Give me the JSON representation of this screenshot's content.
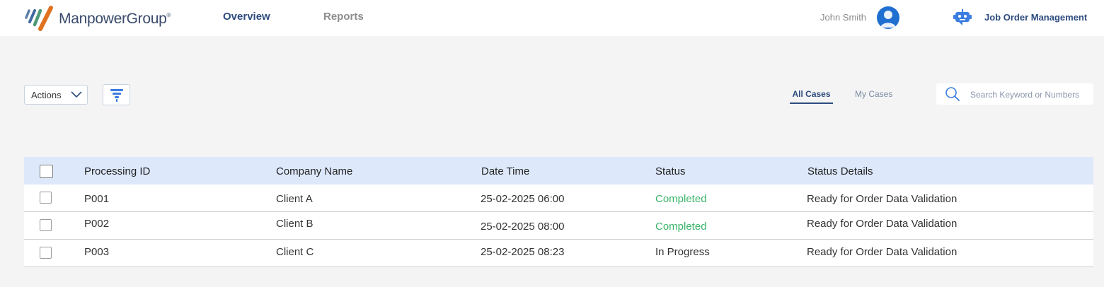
{
  "header": {
    "brand": "ManpowerGroup",
    "brand_mark": "®",
    "nav": [
      {
        "label": "Overview"
      },
      {
        "label": "Reports"
      }
    ],
    "user_name": "John Smith",
    "app_title": "Job Order Management",
    "icons": [
      "manpower-logo",
      "user-avatar-icon",
      "robot-icon"
    ]
  },
  "toolbar": {
    "actions_label": "Actions",
    "case_tabs": [
      {
        "label": "All Cases"
      },
      {
        "label": "My Cases"
      }
    ],
    "search_placeholder": "Search Keyword or Numbers"
  },
  "table": {
    "columns": [
      "Processing ID",
      "Company Name",
      "Date Time",
      "Status",
      "Status Details"
    ],
    "rows": [
      {
        "id": "P001",
        "company": "Client A",
        "datetime": "25-02-2025 06:00",
        "status": "Completed",
        "details": "Ready for Order Data Validation"
      },
      {
        "id": "P002",
        "company": "Client B",
        "datetime": "25-02-2025 08:00",
        "status": "Completed",
        "details": "Ready for Order Data Validation"
      },
      {
        "id": "P003",
        "company": "Client C",
        "datetime": "25-02-2025 08:23",
        "status": "In Progress",
        "details": "Ready for Order Data Validation"
      }
    ]
  },
  "colors": {
    "brand_blue": "#2d4b7e",
    "status_completed": "#3bb56a",
    "header_row": "#dde9fb",
    "avatar": "#1f6fd1",
    "logo_orange": "#e0711f"
  }
}
